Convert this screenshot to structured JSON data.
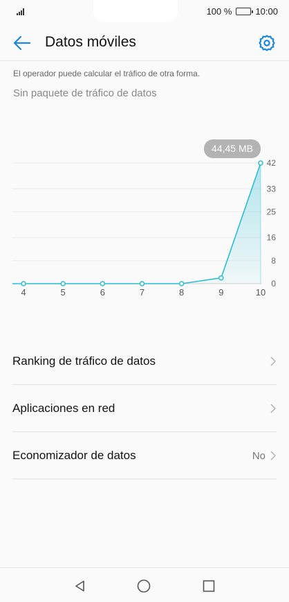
{
  "status_bar": {
    "battery": "100 %",
    "time": "10:00"
  },
  "header": {
    "title": "Datos móviles"
  },
  "note": "El operador puede calcular el tráfico de otra forma.",
  "plan_text": "Sin paquete de tráfico de datos",
  "chart_data": {
    "type": "area",
    "x": [
      4,
      5,
      6,
      7,
      8,
      9,
      10
    ],
    "x_tick_labels": [
      "4",
      "5",
      "6",
      "7",
      "8",
      "9",
      "10"
    ],
    "values": [
      0,
      0,
      0,
      0,
      0,
      2,
      42
    ],
    "y_tick_labels": [
      "42",
      "33",
      "25",
      "16",
      "8",
      "0"
    ],
    "y_ticks": [
      42,
      33,
      25,
      16,
      8,
      0
    ],
    "ylim": [
      0,
      42
    ],
    "tooltip": "44,45 MB",
    "color": "#2bbcd4",
    "grid": true
  },
  "list": {
    "items": [
      {
        "label": "Ranking de tráfico de datos",
        "value": ""
      },
      {
        "label": "Aplicaciones en red",
        "value": ""
      },
      {
        "label": "Economizador de datos",
        "value": "No"
      }
    ]
  },
  "colors": {
    "accent": "#1e88d8",
    "chart_line": "#2bbcd4"
  }
}
